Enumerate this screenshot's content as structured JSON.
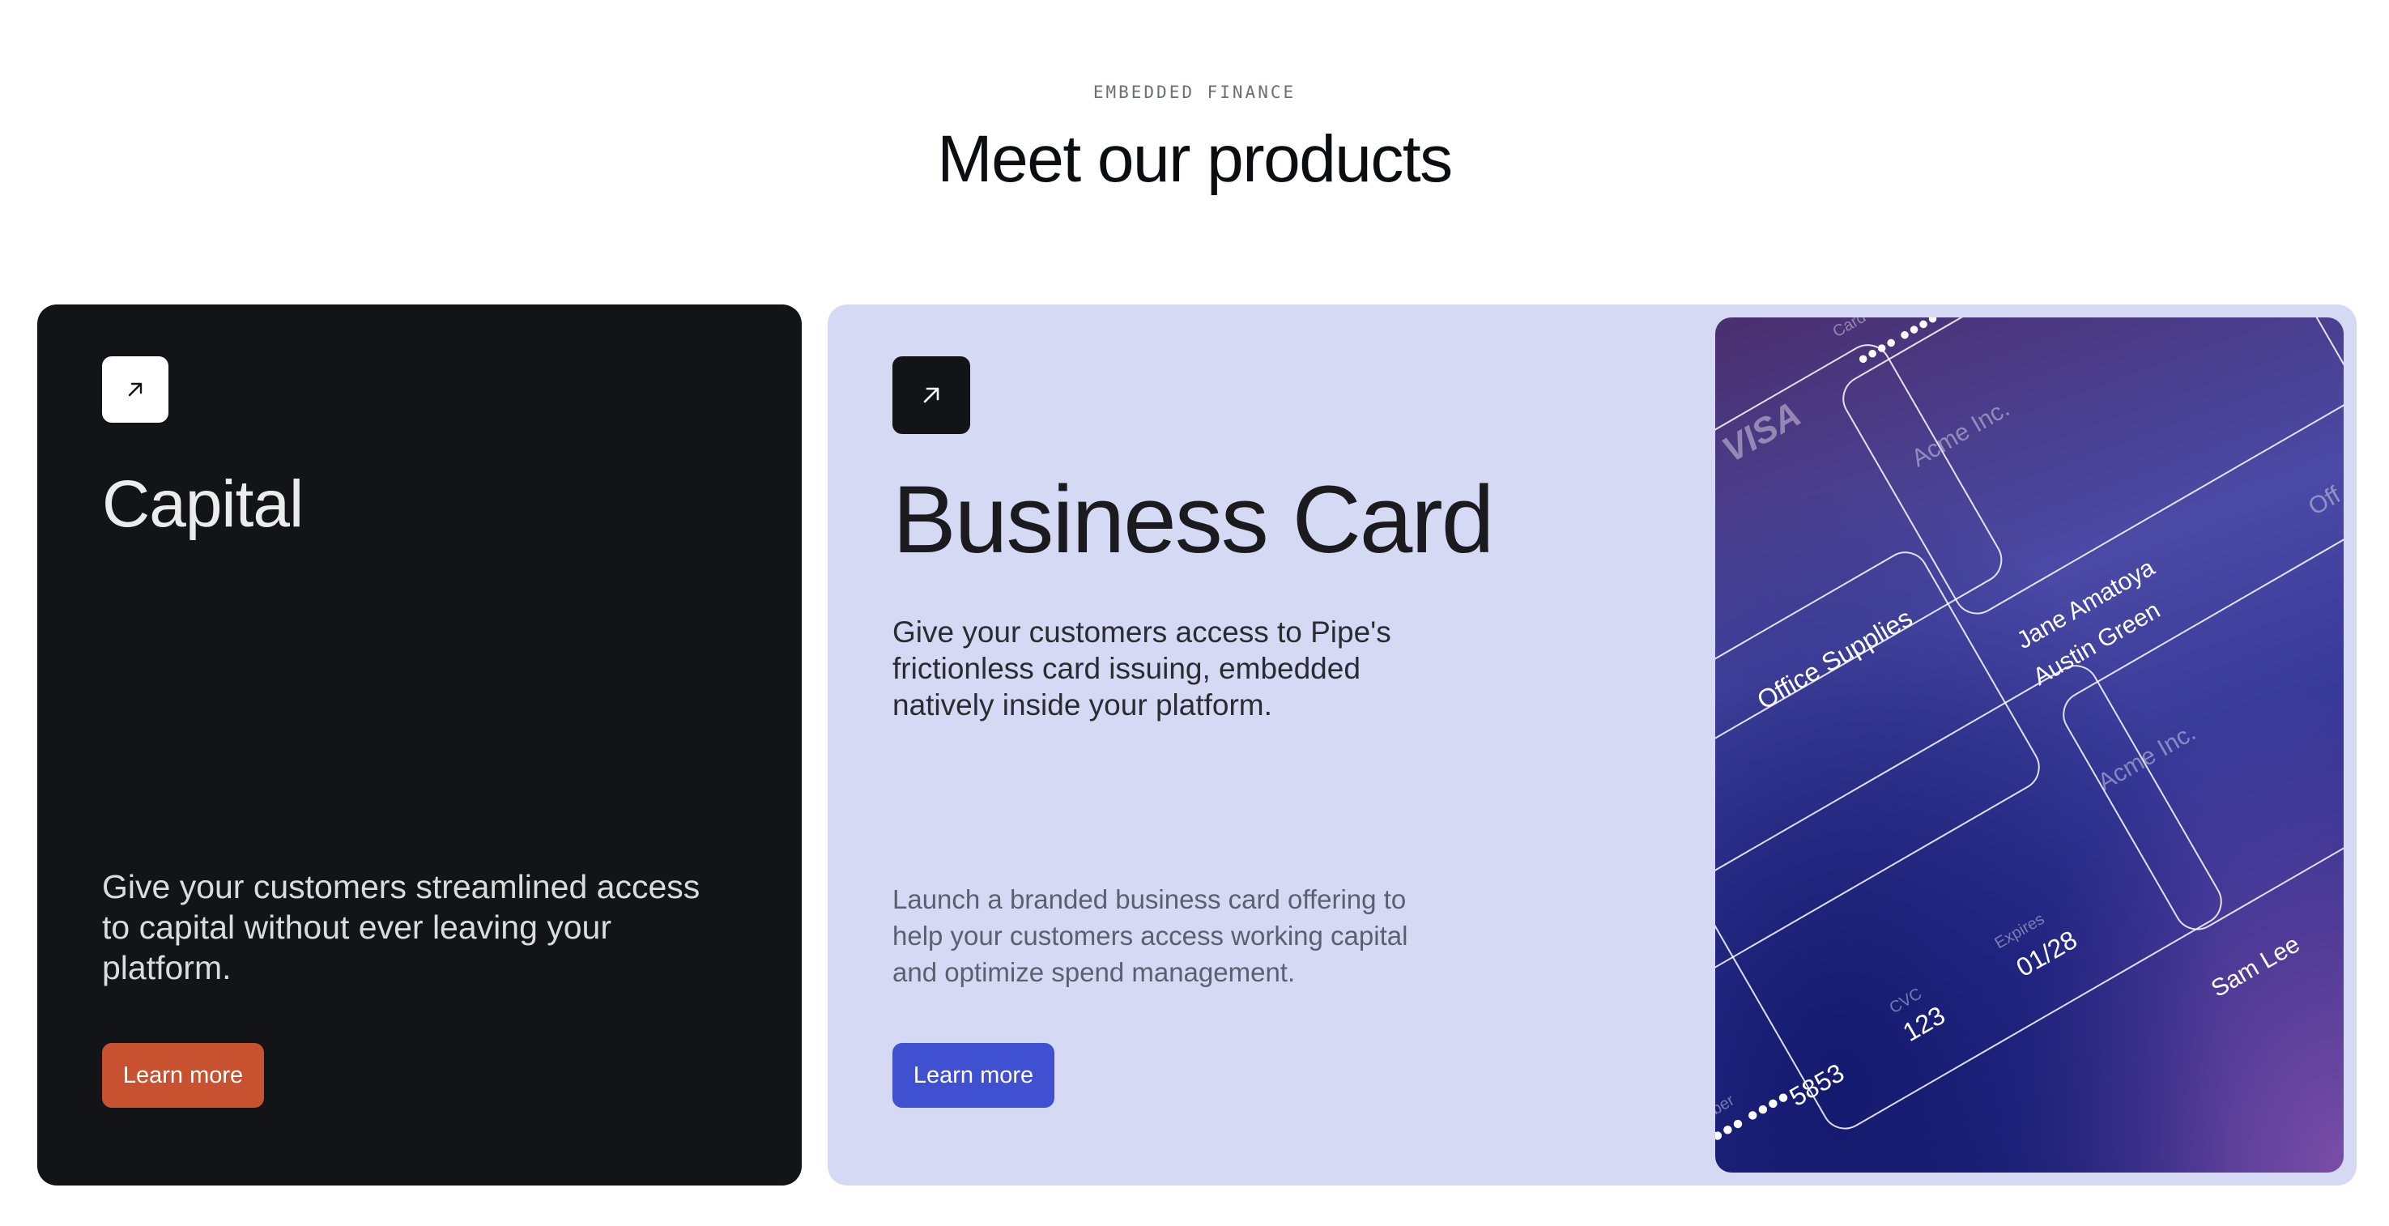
{
  "section": {
    "eyebrow": "EMBEDDED FINANCE",
    "title": "Meet our products"
  },
  "capital": {
    "icon": "arrow-up-right-icon",
    "title": "Capital",
    "description": "Give your customers streamlined access to capital without ever leaving your platform.",
    "button_label": "Learn more",
    "colors": {
      "background": "#131418",
      "button": "#c8522f"
    }
  },
  "business_card": {
    "icon": "arrow-up-right-icon",
    "title": "Business Card",
    "description": "Give your customers access to Pipe's frictionless card issuing, embedded natively inside your platform.",
    "subtext": "Launch a branded business card offering to help your customers access working capital and optimize spend management.",
    "button_label": "Learn more",
    "colors": {
      "background": "#d5d9f3",
      "button": "#3f50d0"
    },
    "visual": {
      "brand": "VISA",
      "company": "Acme Inc.",
      "company_truncated": "Off",
      "card_label_office": "Office Supplies",
      "card_names": [
        "Jane Amatoya",
        "Austin Green"
      ],
      "card_name_sam": "Sam Lee",
      "cvc_label": "CVC",
      "cvc_value": "123",
      "expires_label": "Expires",
      "expires_value": "01/28",
      "number_label_truncated": "ber",
      "number_last4": "5853",
      "top_label_truncated": "Card"
    }
  }
}
